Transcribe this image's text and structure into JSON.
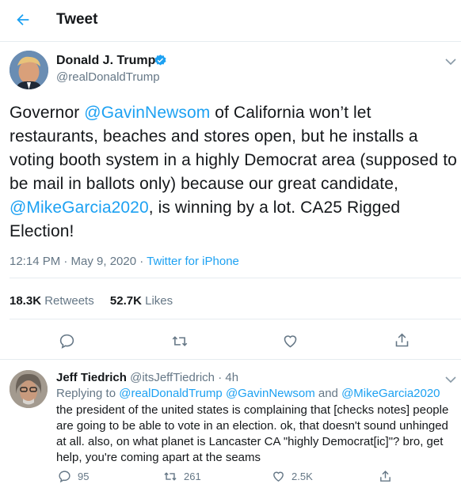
{
  "header": {
    "title": "Tweet"
  },
  "tweet": {
    "author_name": "Donald J. Trump",
    "author_handle": "@realDonaldTrump",
    "text_parts": {
      "p1": "Governor ",
      "m1": "@GavinNewsom",
      "p2": " of California won’t let restaurants, beaches and stores open, but he installs a voting booth system in a highly Democrat area (supposed to be mail in ballots only) because our great candidate, ",
      "m2": "@MikeGarcia2020",
      "p3": ", is winning by a lot. CA25  Rigged Election!"
    },
    "time": "12:14 PM · May 9, 2020 · ",
    "source": "Twitter for iPhone",
    "retweets_count": "18.3K",
    "retweets_label": " Retweets",
    "likes_count": "52.7K",
    "likes_label": " Likes"
  },
  "reply": {
    "author_name": "Jeff Tiedrich",
    "author_handle": "@itsJeffTiedrich · 4h",
    "replying_prefix": "Replying to ",
    "replying_to": "@realDonaldTrump @GavinNewsom",
    "replying_and": " and ",
    "replying_last": "@MikeGarcia2020",
    "text": "the president of the united states is complaining that [checks notes] people are going to be able to vote in an election. ok, that doesn't sound unhinged at all. also, on what planet is Lancaster CA \"highly Democrat[ic]\"? bro, get help, you're coming apart at the seams",
    "replies": "95",
    "retweets": "261",
    "likes": "2.5K"
  },
  "colors": {
    "accent": "#1da1f2",
    "muted": "#657786",
    "divider": "#e6ecf0"
  }
}
